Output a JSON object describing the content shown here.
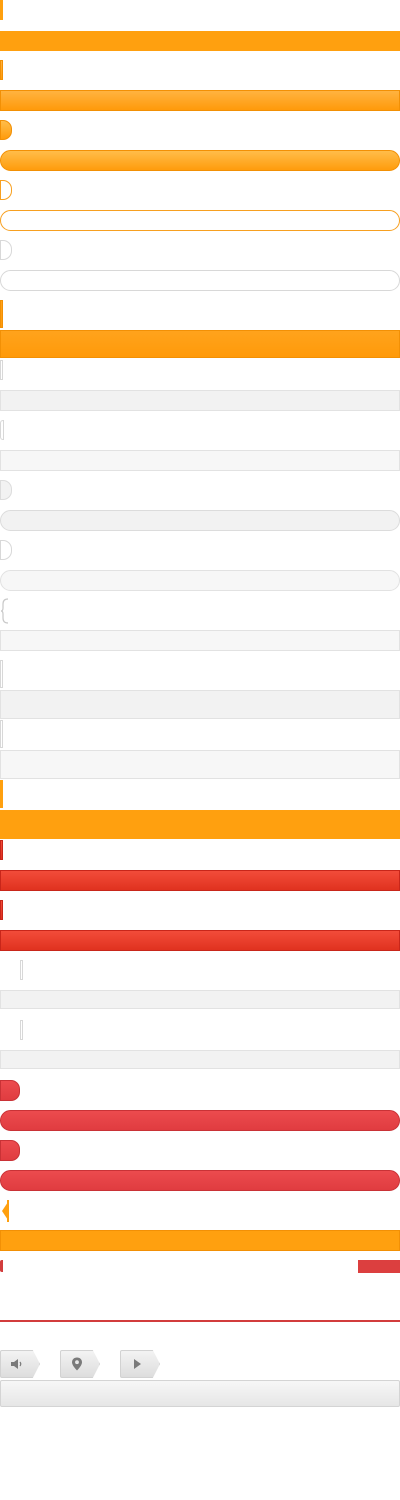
{
  "colors": {
    "accent_orange": "#ffa00f",
    "accent_red": "#e0321f",
    "accent_coral": "#e03c40",
    "neutral_grey": "#f2f2f2",
    "divider_red": "#d23c3c"
  },
  "icons": [
    "volume-icon",
    "location-pin-icon",
    "play-icon"
  ]
}
